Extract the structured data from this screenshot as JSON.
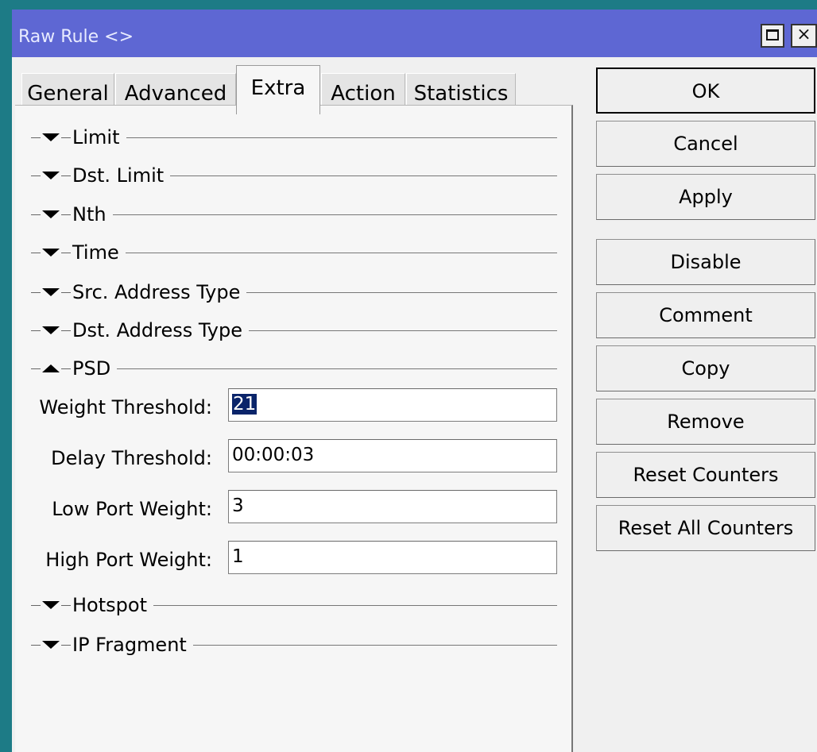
{
  "window": {
    "title": "Raw Rule <>",
    "maximize_icon": "maximize-icon",
    "close_icon": "close-icon",
    "close_glyph": "×"
  },
  "tabs": [
    {
      "label": "General",
      "active": false
    },
    {
      "label": "Advanced",
      "active": false
    },
    {
      "label": "Extra",
      "active": true
    },
    {
      "label": "Action",
      "active": false
    },
    {
      "label": "Statistics",
      "active": false
    }
  ],
  "sections": [
    {
      "label": "Limit",
      "expanded": false
    },
    {
      "label": "Dst. Limit",
      "expanded": false
    },
    {
      "label": "Nth",
      "expanded": false
    },
    {
      "label": "Time",
      "expanded": false
    },
    {
      "label": "Src. Address Type",
      "expanded": false
    },
    {
      "label": "Dst. Address Type",
      "expanded": false
    },
    {
      "label": "PSD",
      "expanded": true
    },
    {
      "label": "Hotspot",
      "expanded": false
    },
    {
      "label": "IP Fragment",
      "expanded": false
    }
  ],
  "psd": {
    "weight_threshold": {
      "label": "Weight Threshold:",
      "value": "21"
    },
    "delay_threshold": {
      "label": "Delay Threshold:",
      "value": "00:00:03"
    },
    "low_port_weight": {
      "label": "Low Port Weight:",
      "value": "3"
    },
    "high_port_weight": {
      "label": "High Port Weight:",
      "value": "1"
    }
  },
  "buttons": {
    "ok": "OK",
    "cancel": "Cancel",
    "apply": "Apply",
    "disable": "Disable",
    "comment": "Comment",
    "copy": "Copy",
    "remove": "Remove",
    "reset_counters": "Reset Counters",
    "reset_all_counters": "Reset All Counters"
  }
}
